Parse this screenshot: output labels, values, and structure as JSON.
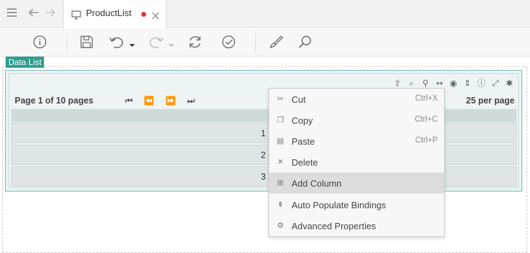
{
  "tab": {
    "title": "ProductList",
    "modified_color": "#d9343a"
  },
  "data_list": {
    "label": "Data List"
  },
  "pager": {
    "text": "Page 1 of 10 pages",
    "per_page": "25 per page"
  },
  "rows": [
    {
      "value": "1"
    },
    {
      "value": "2"
    },
    {
      "value": "3"
    }
  ],
  "context_menu": {
    "items": [
      {
        "label": "Cut",
        "shortcut": "Ctrl+X",
        "icon": "scissors-icon"
      },
      {
        "label": "Copy",
        "shortcut": "Ctrl+C",
        "icon": "copy-icon"
      },
      {
        "label": "Paste",
        "shortcut": "Ctrl+P",
        "icon": "paste-icon"
      },
      {
        "label": "Delete",
        "shortcut": "",
        "icon": "close-icon"
      },
      {
        "label": "Add Column",
        "shortcut": "",
        "icon": "add-column-icon",
        "highlighted": true
      },
      {
        "label": "Auto Populate Bindings",
        "shortcut": "",
        "icon": "auto-populate-icon"
      },
      {
        "label": "Advanced Properties",
        "shortcut": "",
        "icon": "gear-icon"
      }
    ]
  },
  "colors": {
    "accent": "#2f9e8f",
    "grid_border": "#7bb8b2"
  }
}
